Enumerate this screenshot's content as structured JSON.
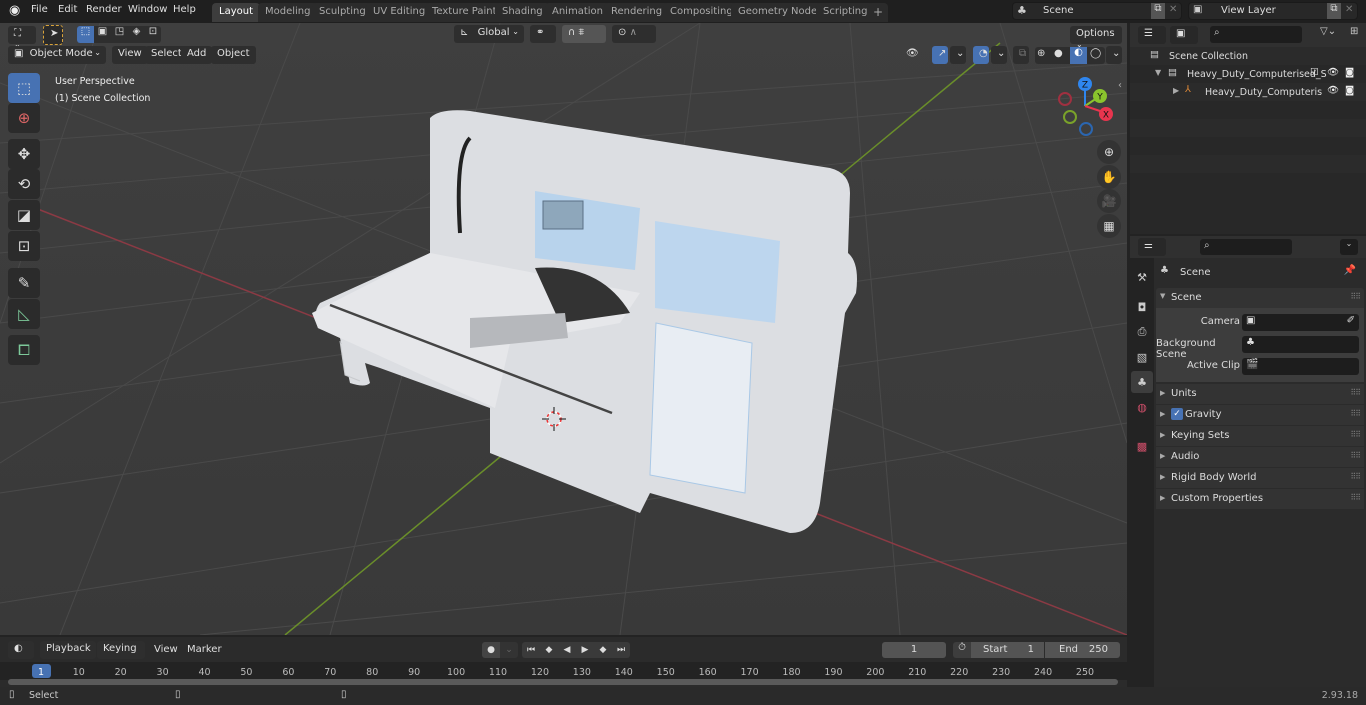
{
  "topbar": {
    "menu": [
      "File",
      "Edit",
      "Render",
      "Window",
      "Help"
    ],
    "workspaces": [
      "Layout",
      "Modeling",
      "Sculpting",
      "UV Editing",
      "Texture Paint",
      "Shading",
      "Animation",
      "Rendering",
      "Compositing",
      "Geometry Nodes",
      "Scripting"
    ],
    "active_workspace": "Layout",
    "add_tab": "+",
    "scene": "Scene",
    "view_layer": "View Layer"
  },
  "viewport": {
    "mode": "Object Mode",
    "menus": [
      "View",
      "Select",
      "Add",
      "Object"
    ],
    "orientation": "Global",
    "options": "Options",
    "overlay_line1": "User Perspective",
    "overlay_line2": "(1) Scene Collection",
    "gizmo_axes": {
      "x": "X",
      "y": "Y",
      "z": "Z"
    },
    "colors": {
      "x": "#e8354e",
      "y": "#8ac42d",
      "z": "#2f86ef",
      "active_tool": "#4772b3"
    },
    "tools": [
      "select-box",
      "cursor",
      "move",
      "rotate",
      "scale",
      "transform",
      "annotate",
      "measure",
      "add-cube"
    ]
  },
  "outliner": {
    "root": "Scene Collection",
    "collection": "Heavy_Duty_Computerised_S",
    "object": "Heavy_Duty_Computeris"
  },
  "properties": {
    "header": "Scene",
    "panel": "Scene",
    "fields": [
      {
        "label": "Camera",
        "value": ""
      },
      {
        "label": "Background Scene",
        "value": ""
      },
      {
        "label": "Active Clip",
        "value": ""
      }
    ],
    "sections": [
      "Units",
      "Gravity",
      "Keying Sets",
      "Audio",
      "Rigid Body World",
      "Custom Properties"
    ],
    "gravity_enabled": true
  },
  "timeline": {
    "menus": [
      "Playback",
      "Keying",
      "View",
      "Marker"
    ],
    "current_frame": "1",
    "start_label": "Start",
    "start": "1",
    "end_label": "End",
    "end": "250",
    "ticks": [
      "1",
      "10",
      "20",
      "30",
      "40",
      "50",
      "60",
      "70",
      "80",
      "90",
      "100",
      "110",
      "120",
      "130",
      "140",
      "150",
      "160",
      "170",
      "180",
      "190",
      "200",
      "210",
      "220",
      "230",
      "240",
      "250"
    ]
  },
  "statusbar": {
    "action": "Select",
    "version": "2.93.18"
  }
}
